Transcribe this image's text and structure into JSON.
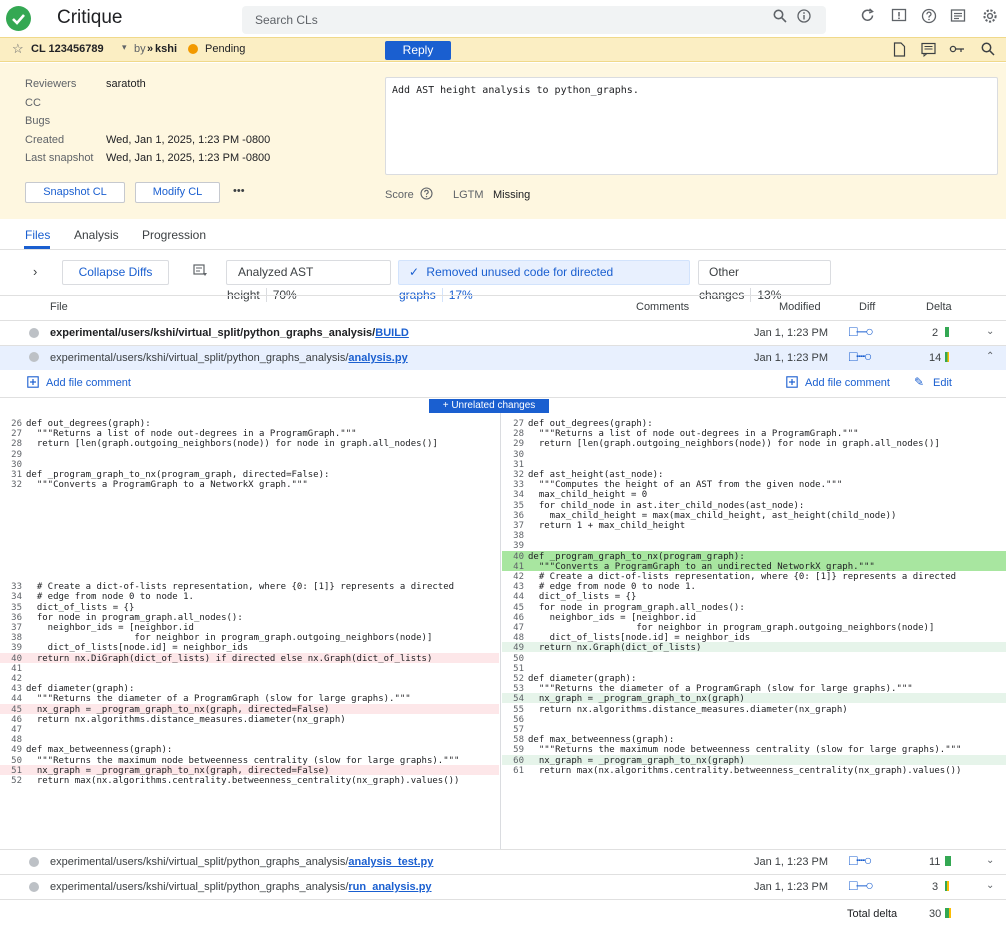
{
  "app": {
    "name": "Critique"
  },
  "search": {
    "placeholder": "Search CLs"
  },
  "cl": {
    "id": "CL 123456789",
    "by": "by",
    "owner": "kshi",
    "status": "Pending",
    "reply_label": "Reply"
  },
  "meta": {
    "reviewers_label": "Reviewers",
    "reviewers_value": "saratoth",
    "cc_label": "CC",
    "bugs_label": "Bugs",
    "created_label": "Created",
    "created_value": "Wed, Jan 1, 2025, 1:23 PM -0800",
    "snapshot_label": "Last snapshot",
    "snapshot_value": "Wed, Jan 1, 2025, 1:23 PM -0800",
    "description": "Add AST height analysis to python_graphs.",
    "snapshot_btn": "Snapshot CL",
    "modify_btn": "Modify CL",
    "more": "•••",
    "score_label": "Score",
    "lgtm_label": "LGTM",
    "lgtm_value": "Missing"
  },
  "tabs": [
    "Files",
    "Analysis",
    "Progression"
  ],
  "toolbar": {
    "collapse": "Collapse Diffs",
    "chip1_label": "Analyzed AST height",
    "chip1_pct": "70%",
    "chip2_label": "Removed unused code for directed graphs",
    "chip2_pct": "17%",
    "chip3_label": "Other changes",
    "chip3_pct": "13%"
  },
  "columns": {
    "file": "File",
    "comments": "Comments",
    "modified": "Modified",
    "diff": "Diff",
    "delta": "Delta"
  },
  "files": [
    {
      "dir": "experimental/users/kshi/virtual_split/python_graphs_analysis/",
      "name": "BUILD",
      "modified": "Jan 1, 1:23 PM",
      "delta": "2"
    },
    {
      "dir": "experimental/users/kshi/virtual_split/python_graphs_analysis/",
      "name": "analysis.py",
      "modified": "Jan 1, 1:23 PM",
      "delta": "14"
    },
    {
      "dir": "experimental/users/kshi/virtual_split/python_graphs_analysis/",
      "name": "analysis_test.py",
      "modified": "Jan 1, 1:23 PM",
      "delta": "11"
    },
    {
      "dir": "experimental/users/kshi/virtual_split/python_graphs_analysis/",
      "name": "run_analysis.py",
      "modified": "Jan 1, 1:23 PM",
      "delta": "3"
    }
  ],
  "file_actions": {
    "add_comment_left": "Add file comment",
    "add_comment_right": "Add file comment",
    "edit": "Edit",
    "unrelated": "+ Unrelated changes"
  },
  "total": {
    "label": "Total delta",
    "value": "30"
  },
  "colors": {
    "accent": "#1a5fd0",
    "added": "#34a853",
    "pending": "#f29900",
    "yellow": "#fbbc04"
  },
  "diff": {
    "left": [
      {
        "n": "26",
        "t": "def out_degrees(graph):"
      },
      {
        "n": "27",
        "t": "  \"\"\"Returns a list of node out-degrees in a ProgramGraph.\"\"\""
      },
      {
        "n": "28",
        "t": "  return [len(graph.outgoing_neighbors(node)) for node in graph.all_nodes()]"
      },
      {
        "n": "29",
        "t": ""
      },
      {
        "n": "30",
        "t": ""
      },
      {
        "n": "31",
        "t": "def _program_graph_to_nx(program_graph, directed=False):"
      },
      {
        "n": "32",
        "t": "  \"\"\"Converts a ProgramGraph to a NetworkX graph.\"\"\""
      },
      {
        "n": "",
        "t": ""
      },
      {
        "n": "",
        "t": ""
      },
      {
        "n": "",
        "t": ""
      },
      {
        "n": "",
        "t": ""
      },
      {
        "n": "",
        "t": ""
      },
      {
        "n": "",
        "t": ""
      },
      {
        "n": "",
        "t": ""
      },
      {
        "n": "",
        "t": ""
      },
      {
        "n": "",
        "t": ""
      },
      {
        "n": "33",
        "t": "  # Create a dict-of-lists representation, where {0: [1]} represents a directed"
      },
      {
        "n": "34",
        "t": "  # edge from node 0 to node 1."
      },
      {
        "n": "35",
        "t": "  dict_of_lists = {}"
      },
      {
        "n": "36",
        "t": "  for node in program_graph.all_nodes():"
      },
      {
        "n": "37",
        "t": "    neighbor_ids = [neighbor.id"
      },
      {
        "n": "38",
        "t": "                    for neighbor in program_graph.outgoing_neighbors(node)]"
      },
      {
        "n": "39",
        "t": "    dict_of_lists[node.id] = neighbor_ids"
      },
      {
        "n": "40",
        "t": "  return nx.DiGraph(dict_of_lists) if directed else nx.Graph(dict_of_lists)",
        "c": "del"
      },
      {
        "n": "41",
        "t": ""
      },
      {
        "n": "42",
        "t": ""
      },
      {
        "n": "43",
        "t": "def diameter(graph):"
      },
      {
        "n": "44",
        "t": "  \"\"\"Returns the diameter of a ProgramGraph (slow for large graphs).\"\"\""
      },
      {
        "n": "45",
        "t": "  nx_graph = _program_graph_to_nx(graph, directed=False)",
        "c": "del"
      },
      {
        "n": "46",
        "t": "  return nx.algorithms.distance_measures.diameter(nx_graph)"
      },
      {
        "n": "47",
        "t": ""
      },
      {
        "n": "48",
        "t": ""
      },
      {
        "n": "49",
        "t": "def max_betweenness(graph):"
      },
      {
        "n": "50",
        "t": "  \"\"\"Returns the maximum node betweenness centrality (slow for large graphs).\"\"\""
      },
      {
        "n": "51",
        "t": "  nx_graph = _program_graph_to_nx(graph, directed=False)",
        "c": "del"
      },
      {
        "n": "52",
        "t": "  return max(nx.algorithms.centrality.betweenness_centrality(nx_graph).values())"
      }
    ],
    "right": [
      {
        "n": "27",
        "t": "def out_degrees(graph):"
      },
      {
        "n": "28",
        "t": "  \"\"\"Returns a list of node out-degrees in a ProgramGraph.\"\"\""
      },
      {
        "n": "29",
        "t": "  return [len(graph.outgoing_neighbors(node)) for node in graph.all_nodes()]"
      },
      {
        "n": "30",
        "t": ""
      },
      {
        "n": "31",
        "t": ""
      },
      {
        "n": "32",
        "t": "def ast_height(ast_node):"
      },
      {
        "n": "33",
        "t": "  \"\"\"Computes the height of an AST from the given node.\"\"\""
      },
      {
        "n": "34",
        "t": "  max_child_height = 0"
      },
      {
        "n": "35",
        "t": "  for child_node in ast.iter_child_nodes(ast_node):"
      },
      {
        "n": "36",
        "t": "    max_child_height = max(max_child_height, ast_height(child_node))"
      },
      {
        "n": "37",
        "t": "  return 1 + max_child_height"
      },
      {
        "n": "38",
        "t": ""
      },
      {
        "n": "39",
        "t": ""
      },
      {
        "n": "40",
        "t": "def _program_graph_to_nx(program_graph):",
        "c": "addstrong"
      },
      {
        "n": "41",
        "t": "  \"\"\"Converts a ProgramGraph to an undirected NetworkX graph.\"\"\"",
        "c": "addstrong"
      },
      {
        "n": "42",
        "t": "  # Create a dict-of-lists representation, where {0: [1]} represents a directed"
      },
      {
        "n": "43",
        "t": "  # edge from node 0 to node 1."
      },
      {
        "n": "44",
        "t": "  dict_of_lists = {}"
      },
      {
        "n": "45",
        "t": "  for node in program_graph.all_nodes():"
      },
      {
        "n": "46",
        "t": "    neighbor_ids = [neighbor.id"
      },
      {
        "n": "47",
        "t": "                    for neighbor in program_graph.outgoing_neighbors(node)]"
      },
      {
        "n": "48",
        "t": "    dict_of_lists[node.id] = neighbor_ids"
      },
      {
        "n": "49",
        "t": "  return nx.Graph(dict_of_lists)",
        "c": "add"
      },
      {
        "n": "50",
        "t": ""
      },
      {
        "n": "51",
        "t": ""
      },
      {
        "n": "52",
        "t": "def diameter(graph):"
      },
      {
        "n": "53",
        "t": "  \"\"\"Returns the diameter of a ProgramGraph (slow for large graphs).\"\"\""
      },
      {
        "n": "54",
        "t": "  nx_graph = _program_graph_to_nx(graph)",
        "c": "add"
      },
      {
        "n": "55",
        "t": "  return nx.algorithms.distance_measures.diameter(nx_graph)"
      },
      {
        "n": "56",
        "t": ""
      },
      {
        "n": "57",
        "t": ""
      },
      {
        "n": "58",
        "t": "def max_betweenness(graph):"
      },
      {
        "n": "59",
        "t": "  \"\"\"Returns the maximum node betweenness centrality (slow for large graphs).\"\"\""
      },
      {
        "n": "60",
        "t": "  nx_graph = _program_graph_to_nx(graph)",
        "c": "add"
      },
      {
        "n": "61",
        "t": "  return max(nx.algorithms.centrality.betweenness_centrality(nx_graph).values())"
      }
    ]
  }
}
